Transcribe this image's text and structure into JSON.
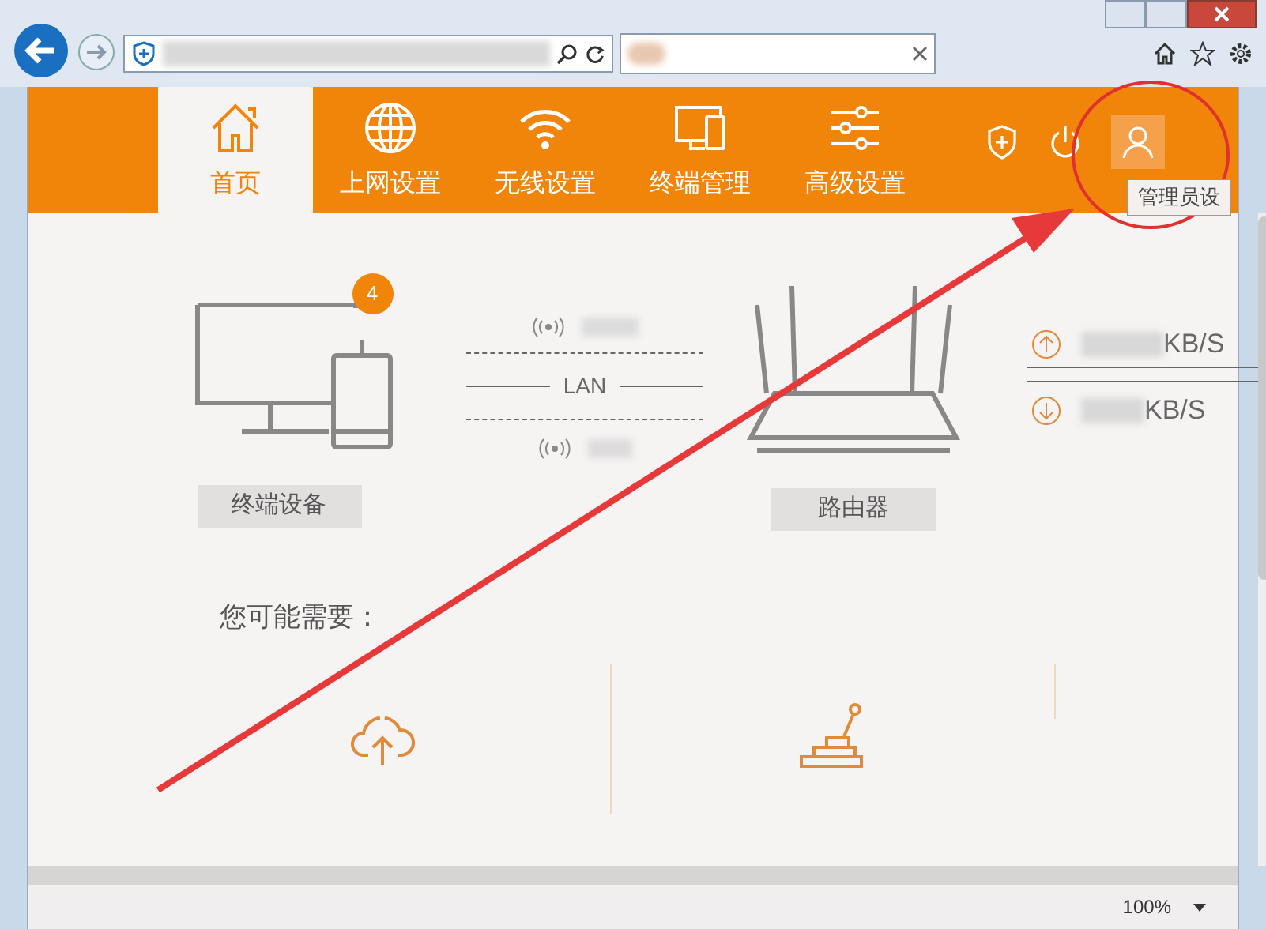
{
  "nav": {
    "tabs": [
      {
        "label": "首页",
        "kind": "home",
        "selected": true
      },
      {
        "label": "上网设置",
        "kind": "globe",
        "selected": false
      },
      {
        "label": "无线设置",
        "kind": "wifi",
        "selected": false
      },
      {
        "label": "终端管理",
        "kind": "devices",
        "selected": false
      },
      {
        "label": "高级设置",
        "kind": "sliders",
        "selected": false
      }
    ],
    "tooltip": "管理员设"
  },
  "status": {
    "devices_badge": "4",
    "devices_label": "终端设备",
    "link_label": "LAN",
    "router_label": "路由器",
    "upload_unit": "KB/S",
    "download_unit": "KB/S"
  },
  "suggestions": {
    "title": "您可能需要："
  },
  "status_bar": {
    "zoom": "100%"
  }
}
